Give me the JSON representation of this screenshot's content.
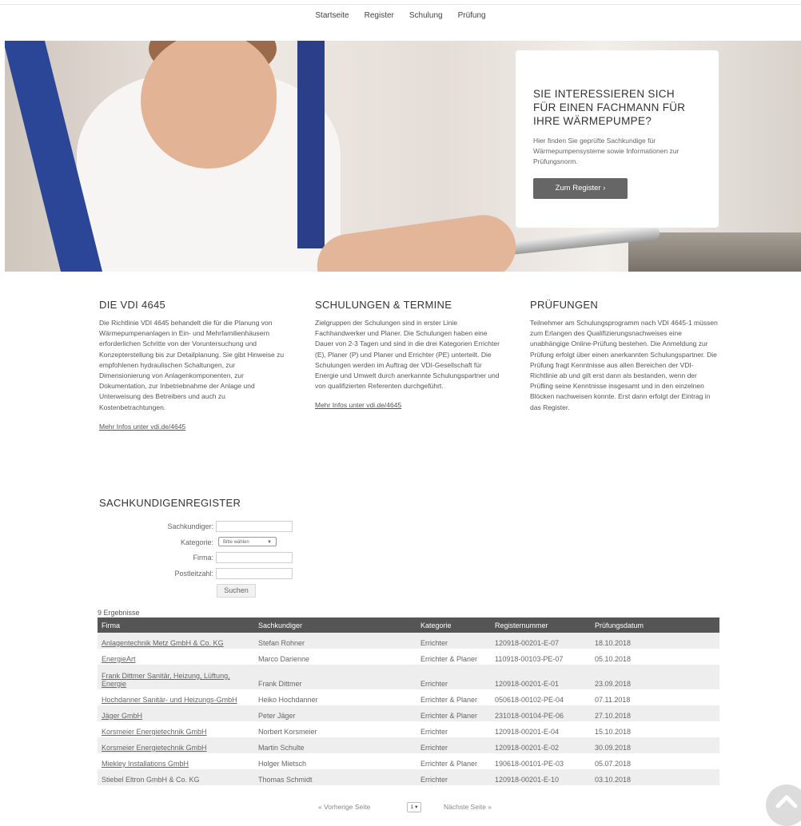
{
  "nav": {
    "items": [
      "Startseite",
      "Register",
      "Schulung",
      "Prüfung"
    ]
  },
  "hero": {
    "title": "SIE INTERESSIEREN SICH FÜR EINEN FACHMANN FÜR IHRE WÄRMEPUMPE?",
    "text": "Hier finden Sie geprüfte Sachkundige für Wärmepumpensysteme sowie Informationen zur Prüfungsnorm.",
    "button": "Zum Register ›"
  },
  "columns": [
    {
      "title": "DIE VDI 4645",
      "text": "Die Richtlinie VDI 4645 behandelt die für die Planung von Wärmepumpenanlagen in Ein- und Mehrfamilienhäusern erforderlichen Schritte von der Voruntersuchung und Konzepterstellung bis zur Detailplanung. Sie gibt Hinweise zu empfohlenen hydraulischen Schaltungen, zur Dimensionierung von Anlagenkomponenten, zur Dokumentation, zur Inbetriebnahme der Anlage und Unterweisung des Betreibers und auch zu Kostenbetrachtungen.",
      "link": "Mehr Infos unter vdi.de/4645"
    },
    {
      "title": "SCHULUNGEN & TERMINE",
      "text": "Zielgruppen der Schulungen sind in erster Linie Fachhandwerker und Planer. Die Schulungen haben eine Dauer von 2-3 Tagen und sind in die drei Kategorien Errichter (E), Planer (P) und Planer und Errichter (PE) unterteilt. Die Schulungen werden im Auftrag der VDI-Gesellschaft für Energie und Umwelt durch anerkannte Schulungspartner und von qualifizierten Referenten durchgeführt.",
      "link": "Mehr Infos unter vdi.de/4645"
    },
    {
      "title": "PRÜFUNGEN",
      "text": "Teilnehmer am Schulungsprogramm nach VDI 4645-1 müssen zum Erlangen des Qualifizierungsnachweises eine unabhängige Online-Prüfung bestehen. Die Anmeldung zur Prüfung erfolgt über einen anerkannten Schulungspartner. Die Prüfung fragt Kenntnisse aus allen Bereichen der VDI-Richtlinie ab und gilt erst dann als bestanden, wenn der Prüfling seine Kenntnisse insgesamt und in den einzelnen Blöcken nachweisen konnte. Erst dann erfolgt der Eintrag in das Register."
    }
  ],
  "register": {
    "title": "SACHKUNDIGENREGISTER",
    "labels": {
      "sachkundiger": "Sachkundiger:",
      "kategorie": "Kategorie:",
      "firma": "Firma:",
      "plz": "Postleitzahl:"
    },
    "kategorie_selected": "Bitte wählen",
    "search_button": "Suchen",
    "result_count": "9 Ergebnisse",
    "columns": [
      "Firma",
      "Sachkundiger",
      "Kategorie",
      "Registernummer",
      "Prüfungsdatum"
    ],
    "rows": [
      [
        "Anlagentechnik Metz GmbH & Co. KG",
        "Stefan Rohner",
        "Errichter",
        "120918-00201-E-07",
        "18.10.2018"
      ],
      [
        "EnergieArt",
        "Marco Darienne",
        "Errichter & Planer",
        "110918-00103-PE-07",
        "05.10.2018"
      ],
      [
        "Frank Dittmer Sanitär, Heizung, Lüftung, Energie",
        "Frank Dittmer",
        "Errichter",
        "120918-00201-E-01",
        "23.09.2018"
      ],
      [
        "Hochdanner Sanitär- und Heizungs-GmbH",
        "Heiko Hochdanner",
        "Errichter & Planer",
        "050618-00102-PE-04",
        "07.11.2018"
      ],
      [
        "Jäger GmbH",
        "Peter Jäger",
        "Errichter & Planer",
        "231018-00104-PE-06",
        "27.10.2018"
      ],
      [
        "Korsmeier Energietechnik GmbH",
        "Norbert Korsmeier",
        "Errichter",
        "120918-00201-E-04",
        "15.10.2018"
      ],
      [
        "Korsmeier Energietechnik GmbH",
        "Martin Schulte",
        "Errichter",
        "120918-00201-E-02",
        "30.09.2018"
      ],
      [
        "Miekley Installations GmbH",
        "Holger Mietsch",
        "Errichter & Planer",
        "190618-00101-PE-03",
        "05.07.2018"
      ],
      [
        "Stiebel Eltron GmbH & Co. KG",
        "Thomas Schmidt",
        "Errichter",
        "120918-00201-E-10",
        "03.10.2018"
      ]
    ],
    "linked_rows": [
      0,
      1,
      2,
      3,
      4,
      5,
      6,
      7
    ]
  },
  "pager": {
    "prev": "« Vorherige Seite",
    "page": "1",
    "next": "Nächste Seite »"
  },
  "icons": {
    "scroll_top": "chevron-up-icon"
  }
}
